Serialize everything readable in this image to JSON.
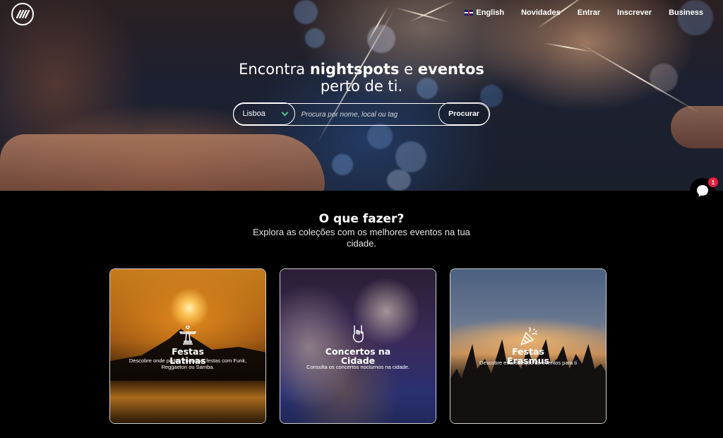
{
  "nav": {
    "language": "English",
    "novidades": "Novidades",
    "entrar": "Entrar",
    "inscrever": "Inscrever",
    "business": "Business"
  },
  "hero": {
    "title_part1": "Encontra ",
    "title_bold1": "nightspots",
    "title_part2": " e ",
    "title_bold2": "eventos",
    "title_line2": "perto de ti."
  },
  "search": {
    "city": "Lisboa",
    "placeholder": "Procura por nome, local ou tag",
    "button": "Procurar"
  },
  "section": {
    "title": "O que fazer?",
    "subtitle": "Explora as coleções com os melhores eventos na tua cidade."
  },
  "cards": [
    {
      "title": "Festas Latinas",
      "desc": "Descobre onde podes encontrar festas com Funk, Reggaeton ou Samba.",
      "icon": "christ-statue-icon"
    },
    {
      "title": "Concertos na Cidade",
      "desc": "Consulta os concertos nocturnos na cidade.",
      "icon": "rock-hand-icon"
    },
    {
      "title": "Festas Erasmus",
      "desc": "Descobre esta seleção de eventos para ti",
      "icon": "party-popper-icon"
    }
  ],
  "chat": {
    "badge": "1"
  },
  "colors": {
    "accent_green": "#4fc38c",
    "badge_red": "#e5213f"
  }
}
